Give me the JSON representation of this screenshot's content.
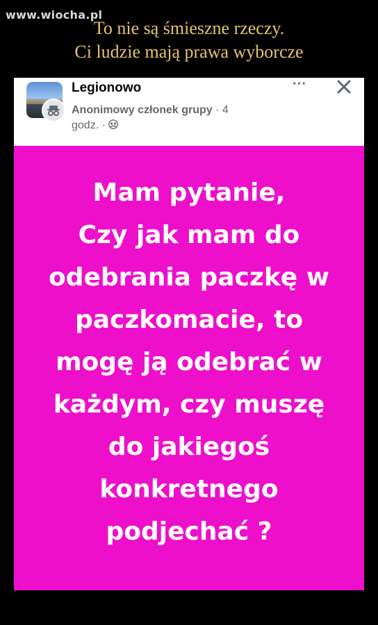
{
  "watermark": "www.wiocha.pl",
  "caption": {
    "line1": "To nie są śmieszne rzeczy.",
    "line2": "Ci ludzie mają prawa wyborcze"
  },
  "post": {
    "group_name": "Legionowo",
    "member": "Anonimowy członek grupy",
    "member_suffix": " · 4",
    "time": "godz. ·",
    "more_label": "···",
    "background_color": "#ee0fcb",
    "text_lines": [
      "Mam pytanie,",
      "Czy jak mam do",
      "odebrania paczkę w",
      "paczkomacie, to",
      "mogę ją odebrać w",
      "każdym, czy muszę",
      "do jakiegoś",
      "konkretnego",
      "podjechać ?"
    ]
  },
  "icons": {
    "group_avatar": "group-photo",
    "user_avatar": "anonymous-icon",
    "audience": "group-audience-icon",
    "more": "more-icon",
    "close": "close-icon"
  }
}
